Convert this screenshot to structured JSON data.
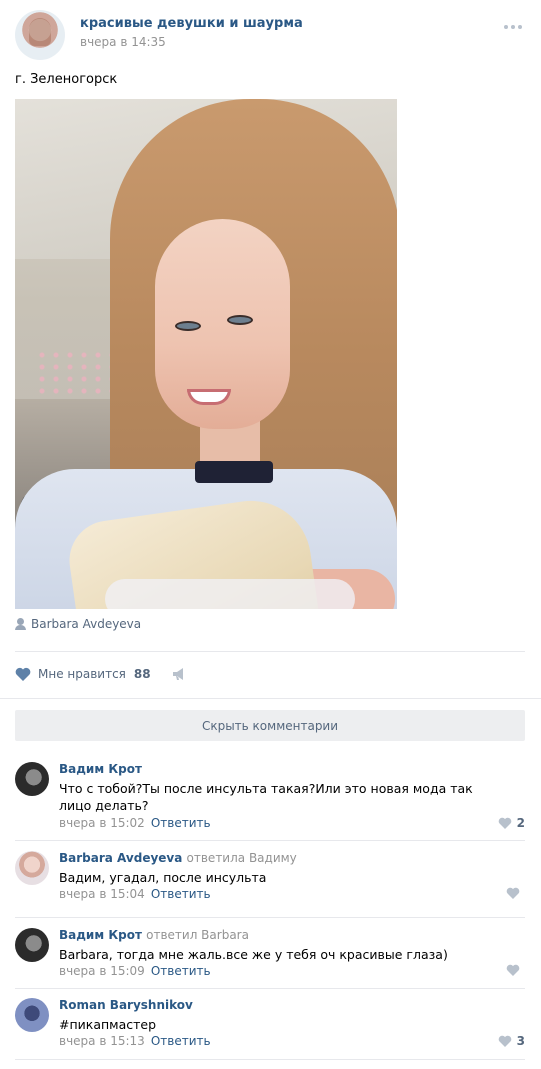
{
  "post": {
    "group_name": "красивые девушки и шаурма",
    "time": "вчера в 14:35",
    "text": "г. Зеленогорск",
    "photo_author": "Barbara Avdeyeva",
    "like_label": "Мне нравится",
    "like_count": "88"
  },
  "hide_comments_label": "Скрыть комментарии",
  "comments": [
    {
      "author": "Вадим Крот",
      "reply_to": "",
      "text": "Что с тобой?Ты после инсульта такая?Или это новая мода так лицо делать?",
      "time": "вчера в 15:02",
      "reply_label": "Ответить",
      "likes": "2"
    },
    {
      "author": "Barbara Avdeyeva",
      "reply_to": "ответила Вадиму",
      "text": "Вадим, угадал, после инсульта",
      "time": "вчера в 15:04",
      "reply_label": "Ответить",
      "likes": ""
    },
    {
      "author": "Вадим Крот",
      "reply_to": "ответил Barbara",
      "text": "Barbara, тогда мне жаль.все же у тебя оч красивые глаза)",
      "time": "вчера в 15:09",
      "reply_label": "Ответить",
      "likes": ""
    },
    {
      "author": "Roman Baryshnikov",
      "reply_to": "",
      "text": "#пикапмастер",
      "time": "вчера в 15:13",
      "reply_label": "Ответить",
      "likes": "3"
    }
  ],
  "colors": {
    "link": "#2a5885",
    "muted": "#939393",
    "icon": "#99a6b7",
    "button_bg": "#edeef0"
  }
}
